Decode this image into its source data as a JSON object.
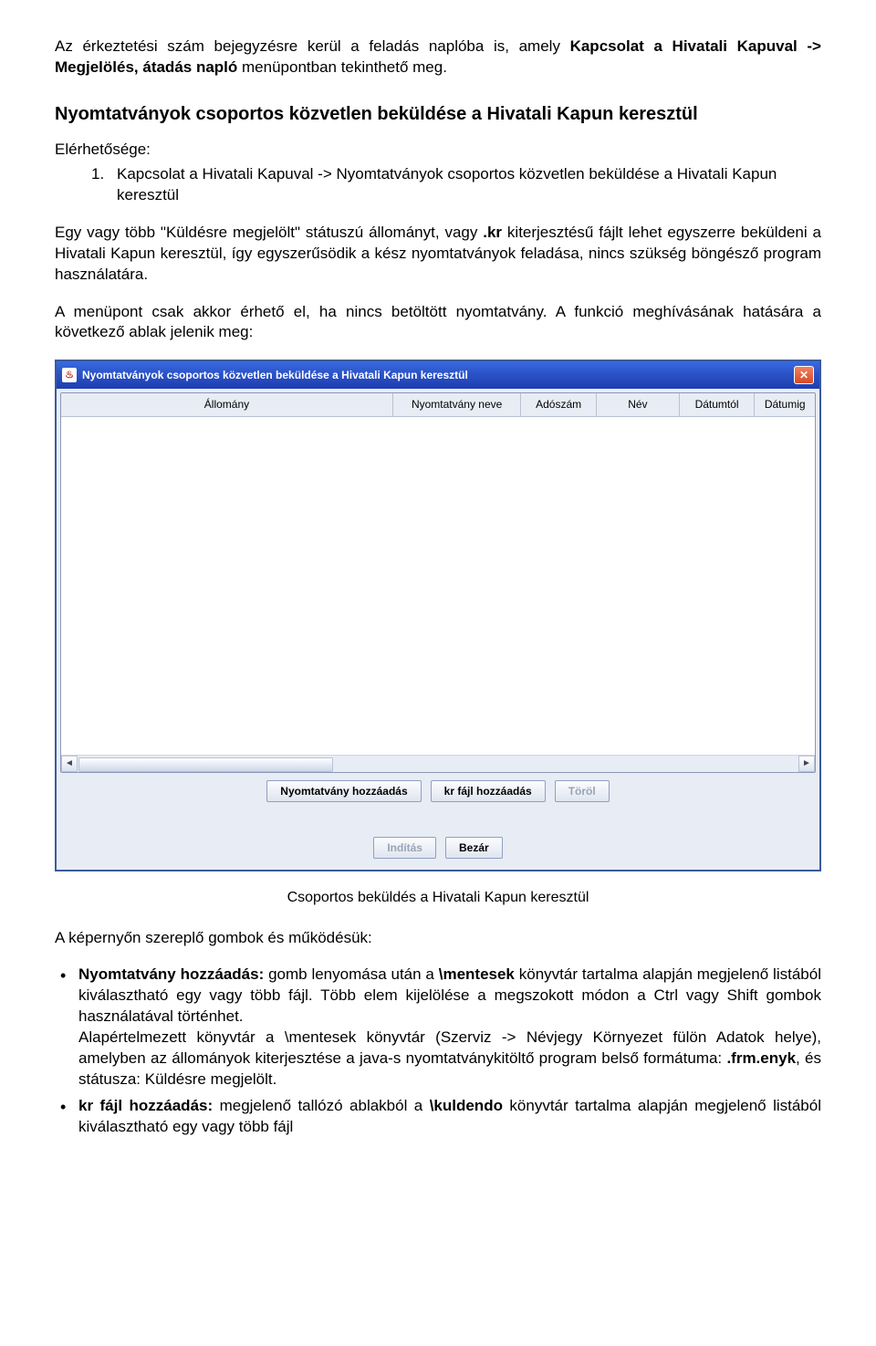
{
  "doc": {
    "para_intro_1": "Az érkeztetési szám bejegyzésre kerül a feladás naplóba is, amely ",
    "para_intro_bold": "Kapcsolat a Hivatali Kapuval -> Megjelölés, átadás napló",
    "para_intro_2": " menüpontban tekinthető meg.",
    "section_title": "Nyomtatványok csoportos közvetlen beküldése a Hivatali Kapun keresztül",
    "avail_label": "Elérhetősége:",
    "avail_item_marker": "1.",
    "avail_item_text": "Kapcsolat a Hivatali Kapuval -> Nyomtatványok csoportos közvetlen beküldése a Hivatali Kapun keresztül",
    "para2_a": "Egy vagy több \"Küldésre megjelölt\" státuszú állományt, vagy ",
    "para2_bold": ".kr",
    "para2_b": " kiterjesztésű fájlt lehet egyszerre beküldeni a Hivatali Kapun keresztül, így egyszerűsödik a kész nyomtatványok feladása, nincs szükség böngésző program használatára.",
    "para3": "A menüpont csak akkor érhető el, ha nincs betöltött nyomtatvány. A funkció meghívásának hatására a következő ablak jelenik meg:",
    "caption": "Csoportos beküldés a Hivatali Kapun keresztül",
    "para4": "A képernyőn szereplő gombok és működésük:",
    "bullets": {
      "b1_label": "Nyomtatvány hozzáadás:",
      "b1_mid": " gomb lenyomása után a ",
      "b1_path": "\\mentesek",
      "b1_rest": " könyvtár tartalma alapján megjelenő listából kiválasztható egy vagy több fájl. Több elem kijelölése a megszokott módon a Ctrl vagy Shift gombok használatával történhet.",
      "b1_p2_a": "Alapértelmezett könyvtár a \\mentesek könyvtár (Szerviz -> Névjegy Környezet fülön Adatok helye), amelyben az állományok kiterjesztése a java-s nyomtatványkitöltő program belső formátuma: ",
      "b1_p2_bold": ".frm.enyk",
      "b1_p2_b": ", és státusza: Küldésre megjelölt.",
      "b2_label": "kr fájl hozzáadás:",
      "b2_mid": " megjelenő tallózó ablakból a ",
      "b2_path": "\\kuldendo",
      "b2_rest": " könyvtár tartalma alapján megjelenő listából kiválasztható egy vagy több fájl"
    }
  },
  "dialog": {
    "title": "Nyomtatványok csoportos közvetlen beküldése a Hivatali Kapun keresztül",
    "java_glyph": "♨",
    "close_glyph": "✕",
    "columns": [
      "Állomány",
      "Nyomtatvány neve",
      "Adószám",
      "Név",
      "Dátumtól",
      "Dátumig"
    ],
    "col_widths": [
      "44%",
      "17%",
      "10%",
      "11%",
      "10%",
      "8%"
    ],
    "buttons_row1": [
      {
        "label": "Nyomtatvány hozzáadás",
        "disabled": false
      },
      {
        "label": "kr fájl hozzáadás",
        "disabled": false
      },
      {
        "label": "Töröl",
        "disabled": true
      }
    ],
    "buttons_row2": [
      {
        "label": "Indítás",
        "disabled": true
      },
      {
        "label": "Bezár",
        "disabled": false
      }
    ],
    "scroll_left": "◄",
    "scroll_right": "►"
  }
}
